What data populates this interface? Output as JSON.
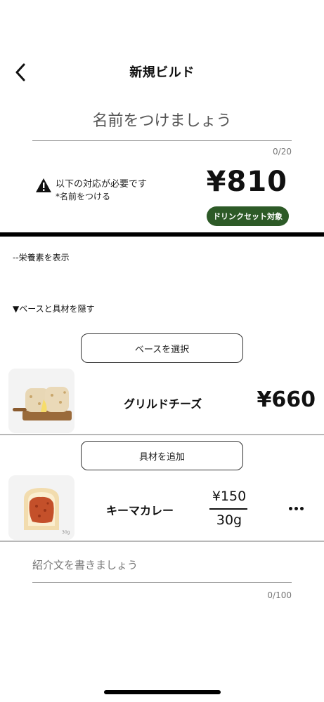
{
  "header": {
    "title": "新規ビルド",
    "back_icon": "chevron-left-icon"
  },
  "name_field": {
    "placeholder": "名前をつけましょう",
    "value": "",
    "counter": "0/20"
  },
  "notice": {
    "icon": "warning-icon",
    "line1": "以下の対応が必要です",
    "line2": "*名前をつける"
  },
  "summary": {
    "total_price": "¥810",
    "badge": "ドリンクセット対象",
    "badge_color": "#2d5a27"
  },
  "toggles": {
    "nutrition": "--栄養素を表示",
    "hide_base": "▼ベースと具材を隠す"
  },
  "base": {
    "select_button": "ベースを選択",
    "item": {
      "name": "グリルドチーズ",
      "price": "¥660",
      "image": "grilled-cheese-sandwich"
    }
  },
  "toppings": {
    "add_button": "具材を追加",
    "items": [
      {
        "name": "キーマカレー",
        "price": "¥150",
        "weight": "30g",
        "image_label": "30g",
        "image": "keema-curry-toast"
      }
    ]
  },
  "intro_field": {
    "placeholder": "紹介文を書きましょう",
    "value": "",
    "counter": "0/100"
  }
}
